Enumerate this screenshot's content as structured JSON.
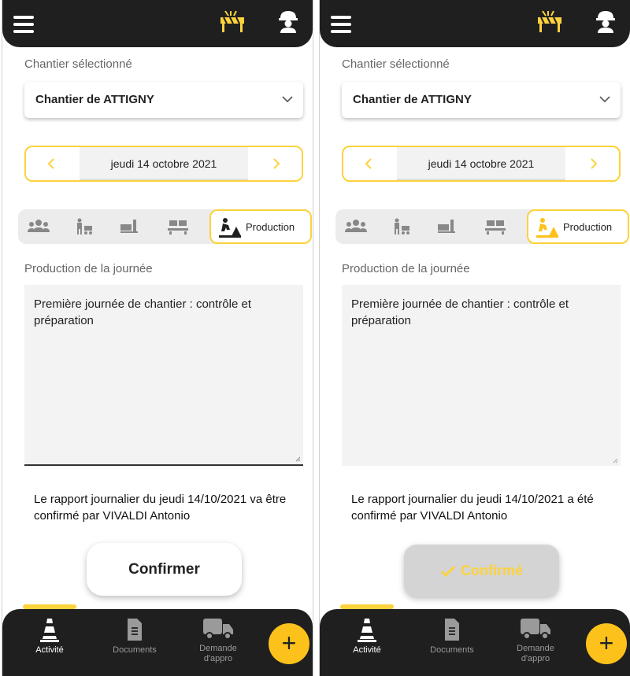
{
  "screens": [
    {
      "site_label": "Chantier sélectionné",
      "site_value": "Chantier de ATTIGNY",
      "date": "jeudi 14 octobre 2021",
      "active_tab_label": "Production",
      "production_label": "Production de la journée",
      "production_text": "Première journée de chantier : contrôle et préparation",
      "report_text": "Le rapport journalier du jeudi 14/10/2021 va être confirmé par VIVALDI Antonio",
      "button_label": "Confirmer",
      "nav": {
        "activite": "Activité",
        "documents": "Documents",
        "demande": "Demande d'appro"
      },
      "fab_label": "+"
    },
    {
      "site_label": "Chantier sélectionné",
      "site_value": "Chantier de ATTIGNY",
      "date": "jeudi 14 octobre 2021",
      "active_tab_label": "Production",
      "production_label": "Production de la journée",
      "production_text": "Première journée de chantier : contrôle et préparation",
      "report_text": "Le rapport journalier du jeudi 14/10/2021 a été confirmé par VIVALDI Antonio",
      "button_label": "Confirmé",
      "nav": {
        "activite": "Activité",
        "documents": "Documents",
        "demande": "Demande d'appro"
      },
      "fab_label": "+"
    }
  ],
  "colors": {
    "accent": "#fcd23c",
    "dark": "#1f1f1f",
    "fab": "#fcc21b",
    "disabled": "#d4d4d4"
  },
  "icons": [
    "menu-icon",
    "construction-barrier-icon",
    "worker-helmet-icon",
    "chevron-down-icon",
    "chevron-left-icon",
    "chevron-right-icon",
    "team-icon",
    "worker-cart-icon",
    "pallet-truck-icon",
    "materials-icon",
    "road-work-icon",
    "check-icon",
    "traffic-cone-icon",
    "document-icon",
    "delivery-truck-icon",
    "plus-icon"
  ]
}
